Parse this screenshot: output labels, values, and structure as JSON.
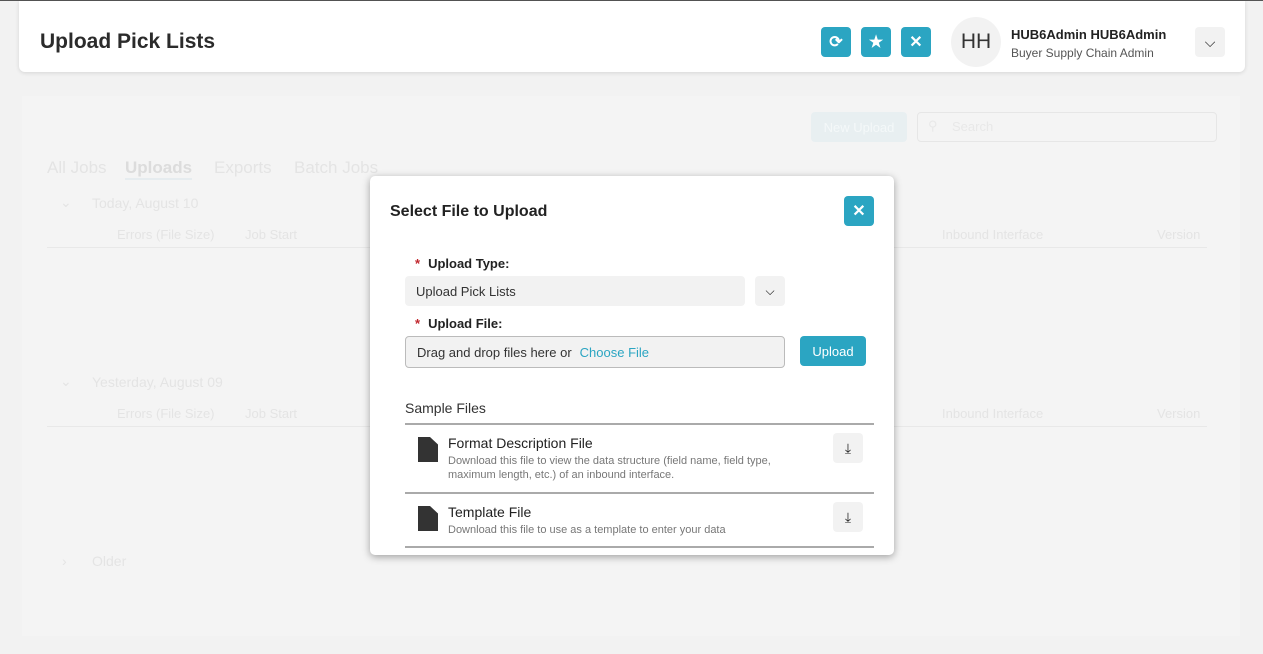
{
  "header": {
    "title": "Upload Pick Lists",
    "user_initials": "HH",
    "user_name": "HUB6Admin HUB6Admin",
    "user_role": "Buyer Supply Chain Admin"
  },
  "background": {
    "new_upload": "New Upload",
    "search_placeholder": "Search",
    "tabs": [
      "All Jobs",
      "Uploads",
      "Exports",
      "Batch Jobs"
    ],
    "groups": [
      {
        "label": "Today, August 10"
      },
      {
        "label": "Yesterday, August 09"
      },
      {
        "label": "Older"
      }
    ],
    "columns": [
      "Errors (File Size)",
      "Job Start",
      "Inbound Interface",
      "Version"
    ]
  },
  "modal": {
    "title": "Select File to Upload",
    "upload_type_label": "Upload Type:",
    "upload_type_value": "Upload Pick Lists",
    "upload_file_label": "Upload File:",
    "drop_text": "Drag and drop files here or",
    "choose_file": "Choose File",
    "upload_button": "Upload",
    "sample_files_title": "Sample Files",
    "files": [
      {
        "name": "Format Description File",
        "desc": "Download this file to view the data structure (field name, field type, maximum length, etc.) of an inbound interface."
      },
      {
        "name": "Template File",
        "desc": "Download this file to use as a template to enter your data"
      }
    ]
  },
  "colors": {
    "accent": "#2ba5c2",
    "required": "#c0262d"
  }
}
